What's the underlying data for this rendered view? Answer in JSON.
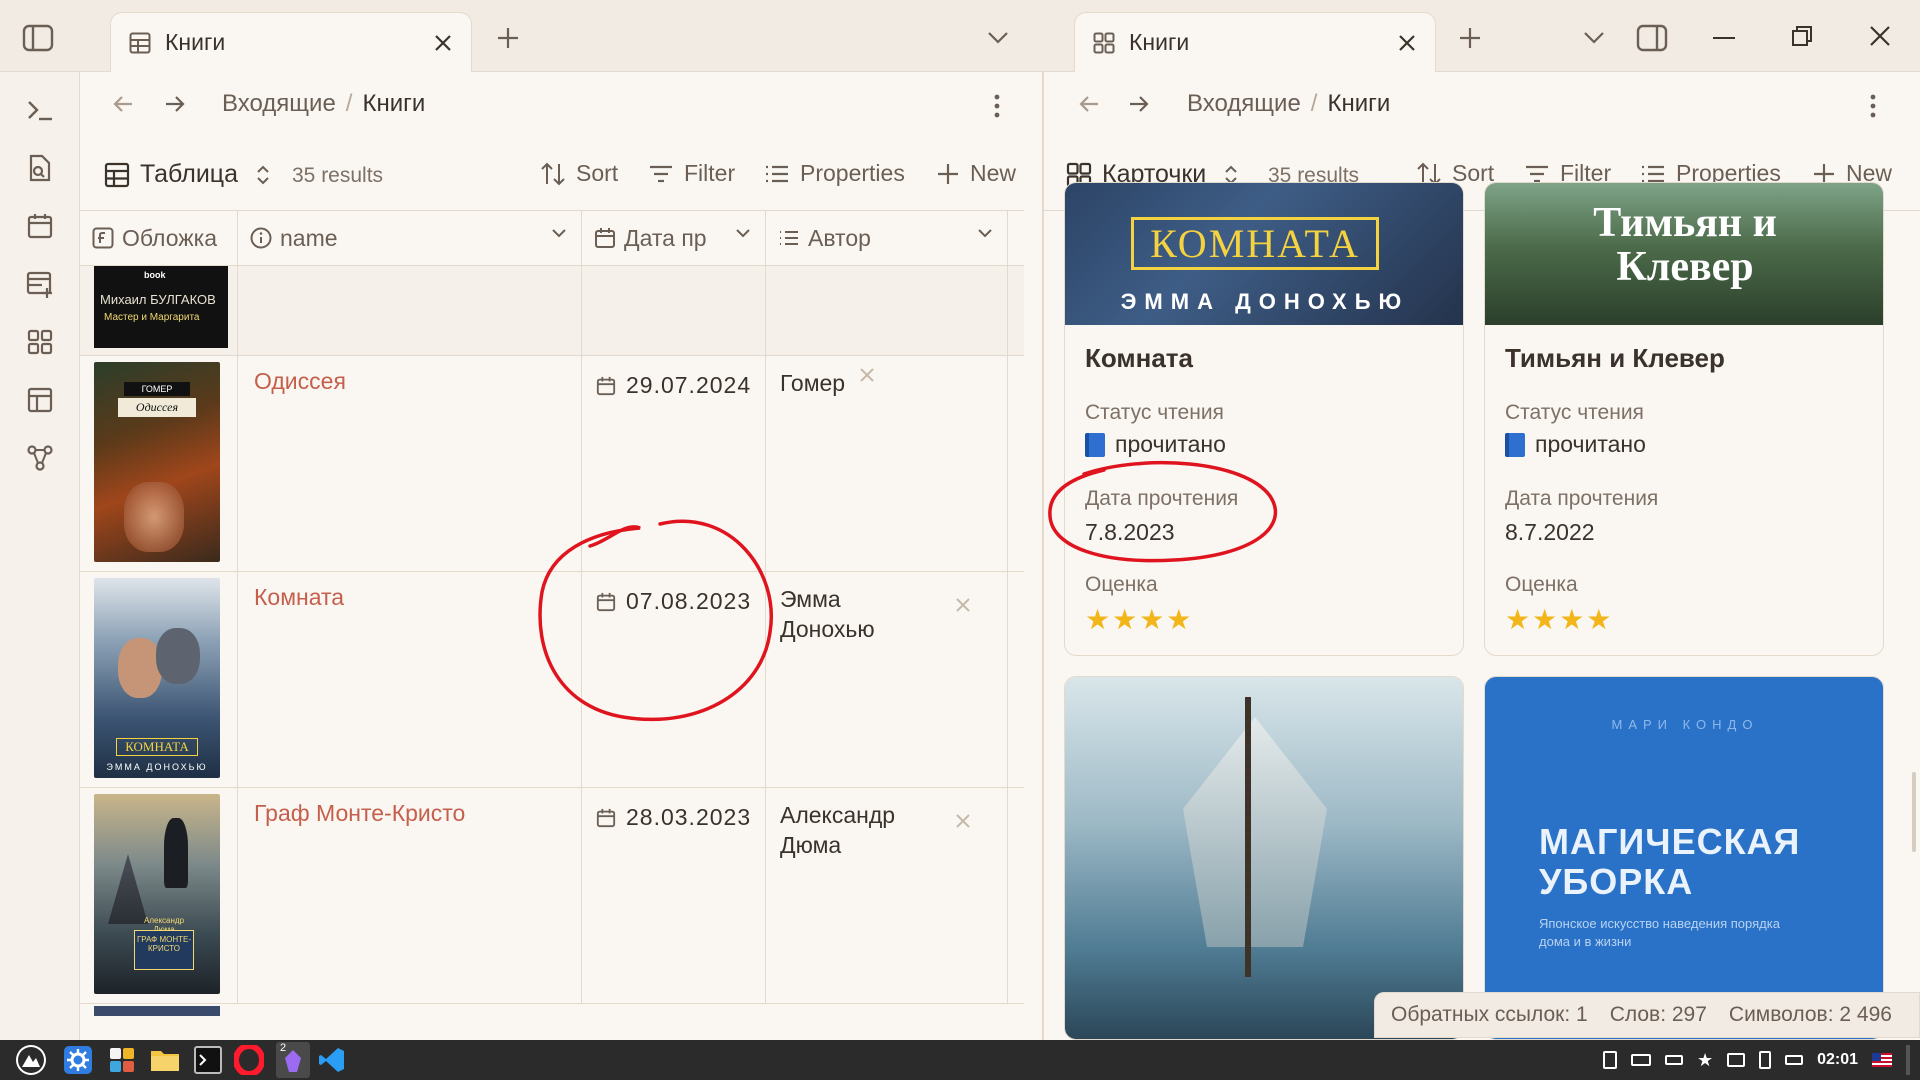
{
  "colors": {
    "accent_link": "#c55f4b",
    "background": "#faf7f2",
    "annotation_red": "#e0141e",
    "border": "#e3d9cc"
  },
  "tabs": {
    "left": {
      "label": "Книги",
      "icon": "table-icon"
    },
    "right": {
      "label": "Книги",
      "icon": "cards-icon"
    }
  },
  "breadcrumb": {
    "parent": "Входящие",
    "sep": "/",
    "current": "Книги"
  },
  "left_toolbar": {
    "view": "Таблица",
    "count": "35 results",
    "sort": "Sort",
    "filter": "Filter",
    "properties": "Properties",
    "new": "New"
  },
  "right_toolbar": {
    "view": "Карточки",
    "count": "35 results",
    "sort": "Sort",
    "filter": "Filter",
    "properties": "Properties",
    "new": "New"
  },
  "table": {
    "columns": [
      "Обложка",
      "name",
      "Дата пр",
      "Автор"
    ],
    "first_cover_text": {
      "author": "Михаил БУЛГАКОВ",
      "title": "Мастер и Маргарита",
      "badge": "book"
    },
    "rows": [
      {
        "name": "Одиссея",
        "date": "29.07.2024",
        "author": "Гомер",
        "cover_title": "Одиссея",
        "cover_label": "ГОМЕР"
      },
      {
        "name": "Комната",
        "date": "07.08.2023",
        "author": "Эмма Донохью",
        "cover_title": "КОМНАТА",
        "cover_label": "ЭММА ДОНОХЬЮ"
      },
      {
        "name": "Граф Монте-Кристо",
        "date": "28.03.2023",
        "author": "Александр Дюма",
        "cover_title": "ГРАФ МОНТЕ-КРИСТО",
        "cover_label": "Александр Дюма"
      }
    ]
  },
  "cards": [
    {
      "title": "Комната",
      "status_label": "Статус чтения",
      "status": "прочитано",
      "date_label": "Дата прочтения",
      "date": "7.8.2023",
      "rating_label": "Оценка",
      "rating": 4,
      "cover_title": "КОМНАТА",
      "cover_author": "ЭММА ДОНОХЬЮ"
    },
    {
      "title": "Тимьян и Клевер",
      "status_label": "Статус чтения",
      "status": "прочитано",
      "date_label": "Дата прочтения",
      "date": "8.7.2022",
      "rating_label": "Оценка",
      "rating": 4,
      "cover_title": "Тимьян и Клевер"
    }
  ],
  "lower_cards": [
    {
      "cover_kind": "ship"
    },
    {
      "cover_author": "МАРИ КОНДО",
      "cover_title_1": "МАГИЧЕСКАЯ",
      "cover_title_2": "УБОРКА",
      "cover_sub": "Японское искусство наведения порядка дома и в жизни"
    }
  ],
  "statusbar": {
    "backlinks": "Обратных ссылок: 1",
    "words": "Слов: 297",
    "chars": "Символов: 2 496"
  },
  "taskbar": {
    "clock": "02:01",
    "badge": "2"
  }
}
